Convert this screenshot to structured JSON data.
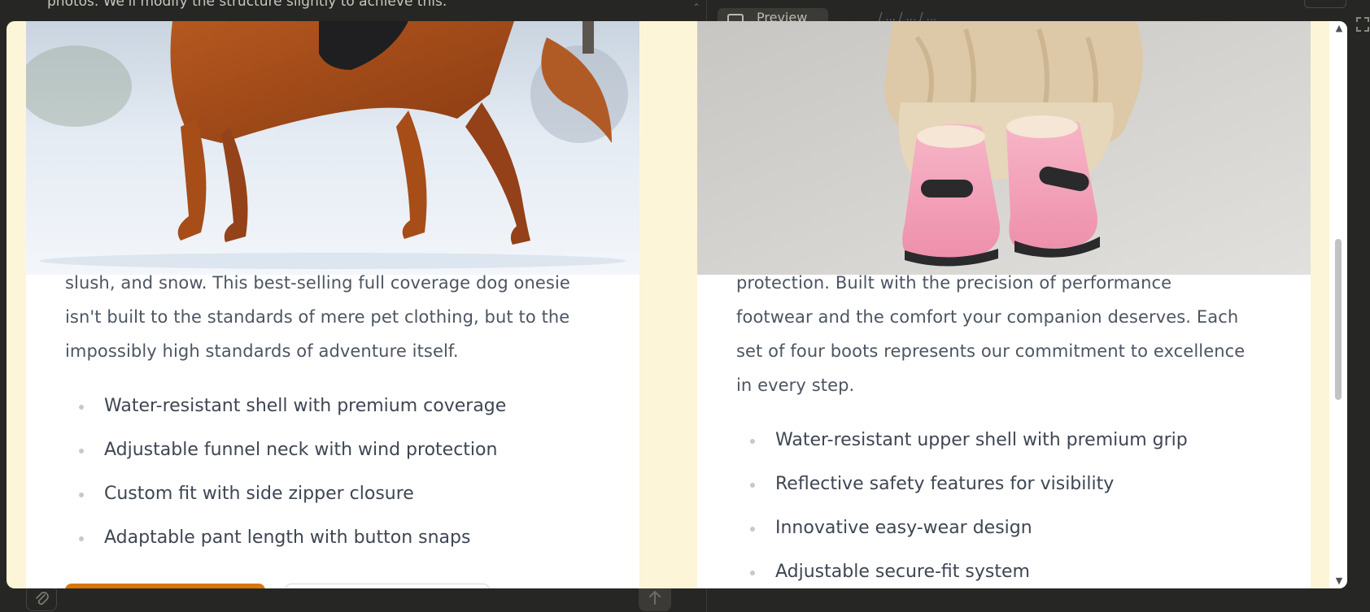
{
  "background": {
    "top_text": "photos. We'll modify the structure slightly to achieve this.",
    "preview_label": "Preview",
    "breadcrumb": "/ ... / ... / ..."
  },
  "colors": {
    "modal_bg": "#fdf5d8",
    "card_bg": "#ffffff",
    "text": "#4d5562",
    "accent": "#d97706",
    "app_bg": "#262624"
  },
  "products": [
    {
      "image_alt": "Golden retriever standing in snow wearing a black coat",
      "description_lines": [
        "slush, and snow. This best-selling full coverage dog onesie",
        "isn't built to the standards of mere pet clothing, but to the",
        "impossibly high standards of adventure itself."
      ],
      "features": [
        "Water-resistant shell with premium coverage",
        "Adjustable funnel neck with wind protection",
        "Custom fit with side zipper closure",
        "Adaptable pant length with button snaps"
      ]
    },
    {
      "image_alt": "Fluffy dog wearing pink snow boots",
      "description_lines": [
        "protection. Built with the precision of performance",
        "footwear and the comfort your companion deserves. Each",
        "set of four boots represents our commitment to excellence",
        "in every step."
      ],
      "features": [
        "Water-resistant upper shell with premium grip",
        "Reflective safety features for visibility",
        "Innovative easy-wear design",
        "Adjustable secure-fit system"
      ]
    }
  ],
  "icons": {
    "attach": "paperclip-icon",
    "send": "arrow-up-icon",
    "scroll_up": "chevron-up-icon",
    "scroll_down": "chevron-down-icon"
  }
}
